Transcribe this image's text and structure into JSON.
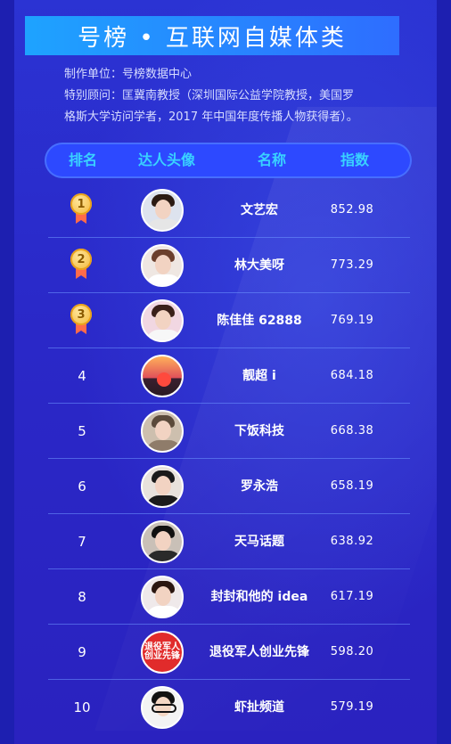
{
  "title": "号榜 • 互联网自媒体类",
  "meta": {
    "producer": "制作单位：号榜数据中心",
    "advisor_line1": "特别顾问：匡冀南教授（深圳国际公益学院教授，美国罗",
    "advisor_line2": "格斯大学访问学者，2017 年中国年度传播人物获得者）。"
  },
  "table": {
    "headers": {
      "rank": "排名",
      "avatar": "达人头像",
      "name": "名称",
      "score": "指数"
    },
    "rows": [
      {
        "rank": "1",
        "name": "文艺宏",
        "score": "852.98"
      },
      {
        "rank": "2",
        "name": "林大美呀",
        "score": "773.29"
      },
      {
        "rank": "3",
        "name": "陈佳佳 62888",
        "score": "769.19"
      },
      {
        "rank": "4",
        "name": "靓超 i",
        "score": "684.18"
      },
      {
        "rank": "5",
        "name": "下饭科技",
        "score": "668.38"
      },
      {
        "rank": "6",
        "name": "罗永浩",
        "score": "658.19"
      },
      {
        "rank": "7",
        "name": "天马话题",
        "score": "638.92"
      },
      {
        "rank": "8",
        "name": "封封和他的 idea",
        "score": "617.19"
      },
      {
        "rank": "9",
        "name": "退役军人创业先锋",
        "score": "598.20",
        "avatar_text": "退役军人创业先锋"
      },
      {
        "rank": "10",
        "name": "虾扯频道",
        "score": "579.19"
      }
    ]
  },
  "colors": {
    "background": "#2a2fc4",
    "header_text": "#39d2ff",
    "title_bar_start": "#1ea3ff",
    "title_bar_end": "#2e6dff",
    "medal_gold": "#f2b531",
    "medal_ribbon": "#ff6b4a"
  }
}
